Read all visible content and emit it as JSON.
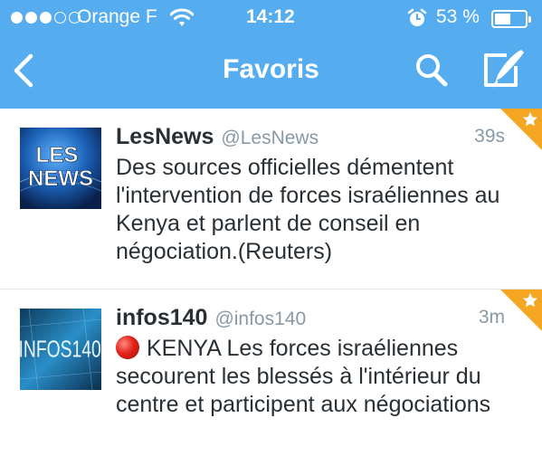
{
  "status_bar": {
    "carrier": "Orange F",
    "time": "14:12",
    "battery_percent": "53 %",
    "battery_level": 0.53,
    "signal_dots_filled": 3,
    "signal_dots_total": 5,
    "icons": [
      "signal-dots-icon",
      "wifi-icon",
      "alarm-icon",
      "battery-icon"
    ]
  },
  "navbar": {
    "title": "Favoris",
    "icons": [
      "back-chevron-icon",
      "search-icon",
      "compose-icon"
    ]
  },
  "tweets": [
    {
      "author": "LesNews",
      "handle": "@LesNews",
      "time": "39s",
      "text": "Des sources officielles démentent l'intervention de forces israéliennes au Kenya et parlent de conseil en négociation.(Reuters)",
      "avatar_text": [
        "LES",
        "NEWS"
      ]
    },
    {
      "author": "infos140",
      "handle": "@infos140",
      "time": "3m",
      "text": "KENYA Les forces israéliennes secourent les blessés à l'intérieur du centre et participent aux négociations",
      "avatar_text": "INFOS140"
    }
  ],
  "colors": {
    "bar": "#55acee",
    "text": "#292f33",
    "muted": "#8899a6",
    "favorite_star": "#f5a623",
    "separator": "#e1e8ed"
  }
}
